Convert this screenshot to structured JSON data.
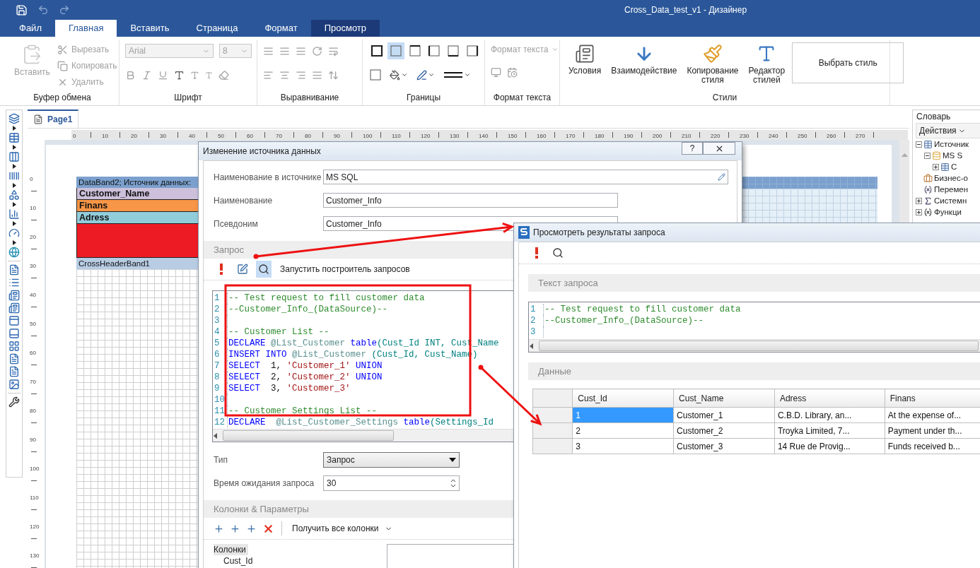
{
  "window": {
    "title": "Cross_Data_test_v1 - Дизайнер"
  },
  "menu_tabs": [
    {
      "label": "Файл",
      "selected": false,
      "highlighted": false
    },
    {
      "label": "Главная",
      "selected": true,
      "highlighted": false
    },
    {
      "label": "Вставить",
      "selected": false,
      "highlighted": false
    },
    {
      "label": "Страница",
      "selected": false,
      "highlighted": false
    },
    {
      "label": "Формат",
      "selected": false,
      "highlighted": false
    },
    {
      "label": "Просмотр",
      "selected": false,
      "highlighted": true
    }
  ],
  "ribbon": {
    "clipboard": {
      "title": "Буфер обмена",
      "paste": {
        "label": "Вставить",
        "disabled": true
      },
      "actions": [
        {
          "label": "Вырезать",
          "kind": "cut",
          "disabled": true
        },
        {
          "label": "Копировать",
          "kind": "copy",
          "disabled": true
        },
        {
          "label": "Удалить",
          "kind": "delete",
          "disabled": true
        }
      ]
    },
    "font": {
      "title": "Шрифт",
      "family": "Arial",
      "size": "8",
      "disabled": true
    },
    "alignment": {
      "title": "Выравнивание"
    },
    "borders": {
      "title": "Границы"
    },
    "text_format": {
      "title": "Формат текста",
      "dropdown": "Формат текста",
      "disabled": true
    },
    "styles": {
      "title": "Стили",
      "buttons": [
        {
          "label": "Условия",
          "kind": "conditions"
        },
        {
          "label": "Взаимодействие",
          "kind": "interaction"
        },
        {
          "label": "Копирование стиля",
          "kind": "brush"
        },
        {
          "label": "Редактор стилей",
          "kind": "editor"
        }
      ],
      "gallery": "Выбрать стиль"
    }
  },
  "page_tab": {
    "label": "Page1",
    "selected": true
  },
  "ruler": {
    "horizontal": [
      "0",
      "10",
      "20",
      "30",
      "40",
      "50",
      "60",
      "70",
      "80",
      "90",
      "100",
      "110",
      "120",
      "130",
      "140",
      "150",
      "160",
      "170",
      "180",
      "190",
      "200",
      "210",
      "220",
      "230",
      "240",
      "250",
      "260",
      "270"
    ],
    "vertical": [
      "0",
      "10",
      "20",
      "30",
      "40",
      "50",
      "60",
      "70",
      "80",
      "90",
      "100",
      "110",
      "120",
      "130"
    ]
  },
  "bands": [
    {
      "label": "DataBand2; Источник данных:",
      "kind": "header",
      "color": "#7ba0cd"
    },
    {
      "label": "Customer_Name",
      "kind": "field",
      "color": "#ccc0da"
    },
    {
      "label": "Finans",
      "kind": "field",
      "color": "#f79646"
    },
    {
      "label": "Adress",
      "kind": "field",
      "color": "#92cddc"
    },
    {
      "kind": "block",
      "color": "#ed1c24"
    },
    {
      "label": "CrossHeaderBand1",
      "kind": "header",
      "color": "#b8cce4"
    }
  ],
  "dictionary": {
    "title": "Словарь",
    "actions": "Действия",
    "tree": [
      {
        "label": "Источник",
        "kind": "table",
        "expanded": true,
        "children": [
          {
            "label": "MS S",
            "kind": "database",
            "expanded": true,
            "children": [
              {
                "label": "C",
                "kind": "table",
                "expanded": false
              }
            ]
          }
        ]
      },
      {
        "label": "Бизнес-о",
        "kind": "business"
      },
      {
        "label": "Перемен",
        "kind": "variable"
      },
      {
        "label": "Системн",
        "kind": "system",
        "expanded": false
      },
      {
        "label": "Функци",
        "kind": "function",
        "expanded": false
      }
    ]
  },
  "source_dialog": {
    "title": "Изменение источника данных",
    "help_button": "?",
    "fields": [
      {
        "label": "Наименование в источнике",
        "value": "MS SQL",
        "kind": "editable"
      },
      {
        "label": "Наименование",
        "value": "Customer_Info",
        "kind": "text"
      },
      {
        "label": "Псевдоним",
        "value": "Customer_Info",
        "kind": "text"
      }
    ],
    "query_section": "Запрос",
    "query_tools": [
      {
        "kind": "run",
        "selected": false
      },
      {
        "kind": "edit",
        "selected": false
      },
      {
        "kind": "preview",
        "selected": true
      }
    ],
    "query_builder_label": "Запустить построитель запросов",
    "code": [
      {
        "number": "1",
        "tokens": [
          {
            "text": "-- Test request to fill customer data",
            "kind": "comment"
          }
        ]
      },
      {
        "number": "2",
        "tokens": [
          {
            "text": "--Customer_Info_(DataSource)--",
            "kind": "comment"
          }
        ]
      },
      {
        "number": "3"
      },
      {
        "number": "4",
        "tokens": [
          {
            "text": "-- Customer List --",
            "kind": "comment"
          }
        ]
      },
      {
        "number": "5",
        "tokens": [
          {
            "text": "DECLARE",
            "kind": "keyword"
          },
          {
            "text": " @List_Customer",
            "kind": "variable"
          },
          {
            "text": " table",
            "kind": "keyword"
          },
          {
            "text": "(Cust_Id INT, Cust_Name",
            "kind": "ident"
          }
        ]
      },
      {
        "number": "6",
        "tokens": [
          {
            "text": "INSERT INTO",
            "kind": "keyword"
          },
          {
            "text": " @List_Customer",
            "kind": "variable"
          },
          {
            "text": " (Cust_Id, Cust_Name)",
            "kind": "ident"
          }
        ]
      },
      {
        "number": "7",
        "tokens": [
          {
            "text": "SELECT",
            "kind": "keyword"
          },
          {
            "text": "  1, ",
            "kind": "plain"
          },
          {
            "text": "'Customer_1'",
            "kind": "string"
          },
          {
            "text": " UNION",
            "kind": "keyword"
          }
        ]
      },
      {
        "number": "8",
        "tokens": [
          {
            "text": "SELECT",
            "kind": "keyword"
          },
          {
            "text": "  2, ",
            "kind": "plain"
          },
          {
            "text": "'Customer_2'",
            "kind": "string"
          },
          {
            "text": " UNION",
            "kind": "keyword"
          }
        ]
      },
      {
        "number": "9",
        "tokens": [
          {
            "text": "SELECT",
            "kind": "keyword"
          },
          {
            "text": "  3, ",
            "kind": "plain"
          },
          {
            "text": "'Customer_3'",
            "kind": "string"
          }
        ]
      },
      {
        "number": "10"
      },
      {
        "number": "11",
        "tokens": [
          {
            "text": "-- Customer Settings List --",
            "kind": "comment"
          }
        ]
      },
      {
        "number": "12",
        "tokens": [
          {
            "text": "DECLARE",
            "kind": "keyword"
          },
          {
            "text": "  @List_Customer_Settings",
            "kind": "variable"
          },
          {
            "text": " table",
            "kind": "keyword"
          },
          {
            "text": "(Settings_Id",
            "kind": "ident"
          }
        ]
      }
    ],
    "type_field": {
      "label": "Тип",
      "value": "Запрос"
    },
    "timeout_field": {
      "label": "Время ожидания запроса",
      "value": "30"
    },
    "columns_section": "Колонки & Параметры",
    "get_columns": "Получить все колонки",
    "columns_tree": [
      {
        "label": "Колонки",
        "selected": true,
        "children": [
          {
            "label": "Cust_Id",
            "selected": false
          }
        ]
      }
    ]
  },
  "preview_dialog": {
    "title": "Просмотреть результаты запроса",
    "tools": [
      {
        "kind": "run"
      },
      {
        "kind": "preview"
      }
    ],
    "query_section": "Текст запроса",
    "code": [
      {
        "number": "1",
        "tokens": [
          {
            "text": "-- Test request to fill customer data",
            "kind": "comment"
          }
        ]
      },
      {
        "number": "2",
        "tokens": [
          {
            "text": "--Customer_Info_(DataSource)--",
            "kind": "comment"
          }
        ]
      },
      {
        "number": "3"
      }
    ],
    "data_section": "Данные",
    "table": {
      "columns": [
        "Cust_Id",
        "Cust_Name",
        "Adress",
        "Finans"
      ],
      "rows": [
        {
          "selected": true,
          "cells": [
            "1",
            "Customer_1",
            "C.B.D. Library, an...",
            "At the expense of..."
          ]
        },
        {
          "selected": false,
          "cells": [
            "2",
            "Customer_2",
            "Troyka Limited, 7...",
            "Payment under th..."
          ]
        },
        {
          "selected": false,
          "cells": [
            "3",
            "Customer_3",
            "14 Rue de Provig...",
            "Funds received b..."
          ]
        }
      ]
    }
  },
  "annotations": [
    {
      "kind": "arrow"
    },
    {
      "kind": "frame"
    },
    {
      "kind": "arrow"
    }
  ]
}
